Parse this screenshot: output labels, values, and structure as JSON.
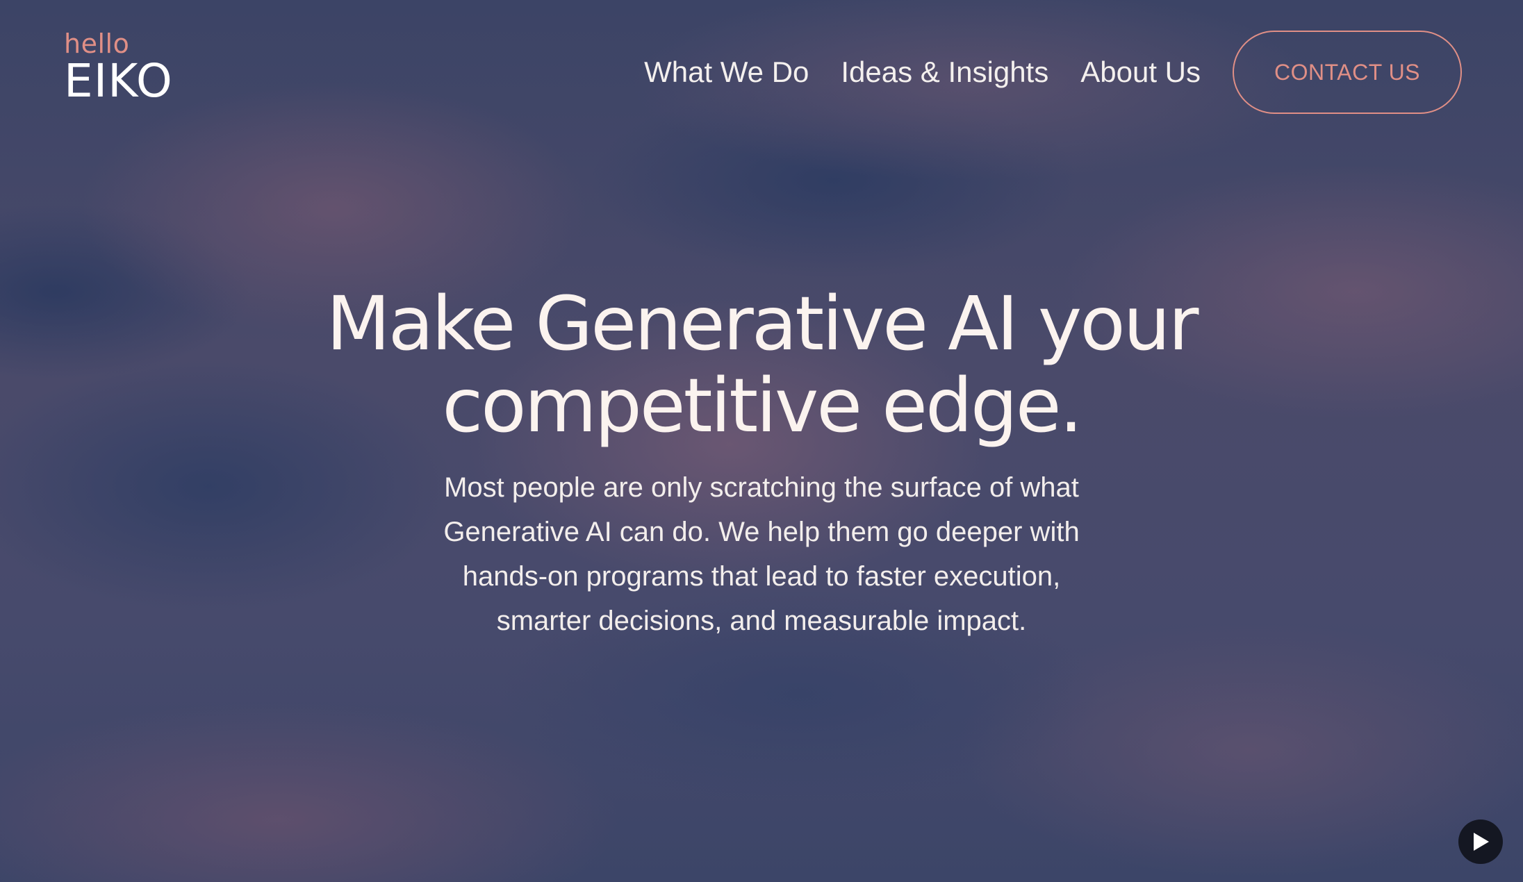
{
  "logo": {
    "greeting": "hello",
    "name": "EIKO"
  },
  "nav": {
    "items": [
      {
        "label": "What We Do"
      },
      {
        "label": "Ideas & Insights"
      },
      {
        "label": "About Us"
      }
    ],
    "contact_label": "CONTACT US"
  },
  "hero": {
    "title_lines": [
      "Make Generative AI your",
      "competitive edge."
    ],
    "subtitle_lines": [
      "Most people are only scratching the surface of what",
      "Generative AI can do. We help them go deeper with",
      "hands-on programs that lead to faster execution,",
      "smarter decisions, and measurable impact."
    ]
  },
  "media": {
    "play_icon": "play-icon"
  },
  "colors": {
    "accent": "#e08f86",
    "text": "#fbf3ef",
    "play_bg": "#141722"
  }
}
